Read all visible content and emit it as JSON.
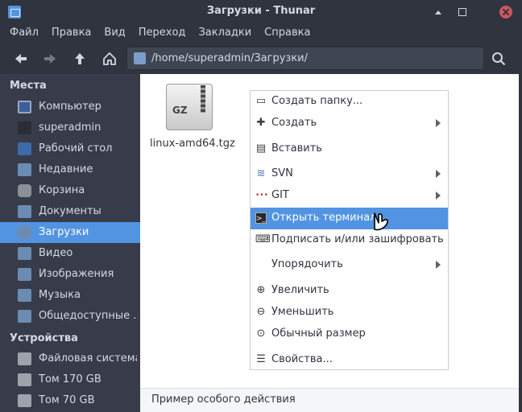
{
  "window": {
    "title": "Загрузки - Thunar"
  },
  "menubar": [
    "Файл",
    "Правка",
    "Вид",
    "Переход",
    "Закладки",
    "Справка"
  ],
  "toolbar": {
    "location_path": "/home/superadmin/Загрузки/"
  },
  "sidebar": {
    "places_header": "Места",
    "places": [
      {
        "label": "Компьютер",
        "icon": "computer-icon"
      },
      {
        "label": "superadmin",
        "icon": "home-icon"
      },
      {
        "label": "Рабочий стол",
        "icon": "desktop-icon"
      },
      {
        "label": "Недавние",
        "icon": "recent-icon"
      },
      {
        "label": "Корзина",
        "icon": "trash-icon"
      },
      {
        "label": "Документы",
        "icon": "folder-icon"
      },
      {
        "label": "Загрузки",
        "icon": "folder-icon",
        "active": true
      },
      {
        "label": "Видео",
        "icon": "folder-icon"
      },
      {
        "label": "Изображения",
        "icon": "folder-icon"
      },
      {
        "label": "Музыка",
        "icon": "folder-icon"
      },
      {
        "label": "Общедоступные ...",
        "icon": "folder-icon"
      }
    ],
    "devices_header": "Устройства",
    "devices": [
      {
        "label": "Файловая система",
        "icon": "drive-icon"
      },
      {
        "label": "Том 170 GB",
        "icon": "drive-icon"
      },
      {
        "label": "Том 70 GB",
        "icon": "drive-icon"
      }
    ]
  },
  "files": [
    {
      "name": "linux-amd64.tgz",
      "badge": "GZ"
    }
  ],
  "context_menu": [
    {
      "label": "Создать папку...",
      "icon": "new-folder-icon"
    },
    {
      "label": "Создать",
      "icon": "create-document-icon",
      "submenu": true
    },
    {
      "label": "Вставить",
      "icon": "paste-icon"
    },
    {
      "label": "SVN",
      "icon": "svn-icon",
      "submenu": true
    },
    {
      "label": "GIT",
      "icon": "git-icon",
      "submenu": true
    },
    {
      "label": "Открыть терминал",
      "icon": "terminal-icon",
      "highlighted": true
    },
    {
      "label": "Подписать и/или зашифровать",
      "icon": "encrypt-icon"
    },
    {
      "label": "Упорядочить",
      "icon": "",
      "submenu": true
    },
    {
      "label": "Увеличить",
      "icon": "zoom-in-icon"
    },
    {
      "label": "Уменьшить",
      "icon": "zoom-out-icon"
    },
    {
      "label": "Обычный размер",
      "icon": "zoom-original-icon"
    },
    {
      "label": "Свойства...",
      "icon": "properties-icon"
    }
  ],
  "statusbar": {
    "text": "Пример особого действия"
  }
}
